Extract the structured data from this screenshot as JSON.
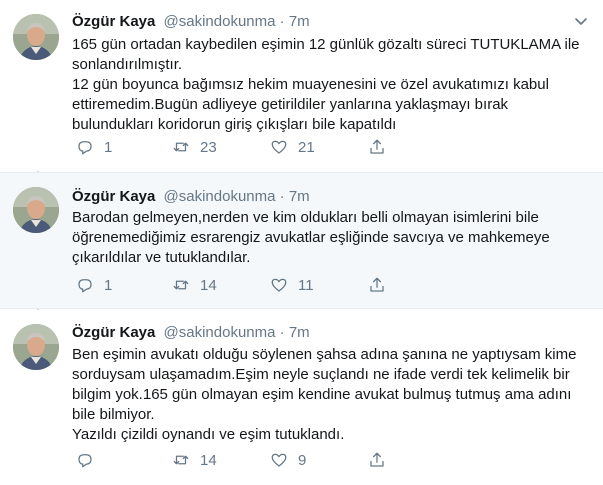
{
  "tweets": [
    {
      "author": "Özgür Kaya",
      "handle": "@sakindokunma",
      "separator": "·",
      "time": "7m",
      "lines": [
        "165 gün ortadan kaybedilen eşimin 12 günlük gözaltı süreci TUTUKLAMA ile",
        "sonlandırılmıştır.",
        "12 gün boyunca bağımsız hekim muayenesini ve özel avukatımızı kabul",
        "ettiremedim.Bugün adliyeye getirildiler yanlarına yaklaşmayı bırak",
        "bulundukları koridorun giriş çıkışları bile kapatıldı"
      ],
      "replies": "1",
      "retweets": "23",
      "likes": "21"
    },
    {
      "author": "Özgür Kaya",
      "handle": "@sakindokunma",
      "separator": "·",
      "time": "7m",
      "lines": [
        "Barodan gelmeyen,nerden ve kim oldukları belli olmayan isimlerini bile",
        "öğrenemediğimiz esrarengiz avukatlar eşliğinde savcıya ve mahkemeye",
        "çıkarıldılar ve tutuklandılar."
      ],
      "replies": "1",
      "retweets": "14",
      "likes": "11"
    },
    {
      "author": "Özgür Kaya",
      "handle": "@sakindokunma",
      "separator": "·",
      "time": "7m",
      "lines": [
        "Ben eşimin avukatı olduğu söylenen şahsa adına şanına ne yaptıysam kime",
        "sorduysam ulaşamadım.Eşim neyle suçlandı ne ifade verdi tek kelimelik bir",
        "bilgim yok.165 gün olmayan eşim kendine avukat bulmuş tutmuş ama adını",
        "bile bilmiyor.",
        "Yazıldı çizildi oynandı ve eşim tutuklandı."
      ],
      "replies": "",
      "retweets": "14",
      "likes": "9"
    }
  ],
  "icons": {
    "reply": "reply-icon",
    "retweet": "retweet-icon",
    "like": "heart-icon",
    "share": "share-icon",
    "caret": "chevron-down-icon"
  },
  "colors": {
    "text": "#14171a",
    "muted": "#657786",
    "highlight_bg": "#f5f8fa",
    "thread_line": "#ccd6dd"
  }
}
